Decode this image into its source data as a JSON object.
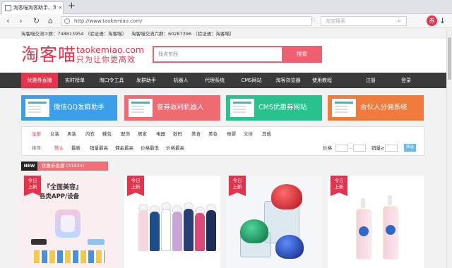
{
  "browser": {
    "tab_title": "淘客喵淘客助手、淘客内",
    "tab_close": "×",
    "new_tab": "+",
    "back_icon": "‹",
    "forward_icon": "›",
    "reload_icon": "↻",
    "home_icon": "⌂",
    "url": "http://www.taokemiao.com/",
    "star_icon": "☆",
    "search_placeholder": "淘宝搜索",
    "search_icon": "⌕",
    "extension_label": "券",
    "download_icon": "↓"
  },
  "qq": {
    "group1": "淘客喵交流①群：748813954 （验证语：淘客喵）",
    "group2": "淘客喵交流六群：60287396 （验证语：淘客喵）"
  },
  "header": {
    "logo_cn": "淘客喵",
    "logo_domain": "taokemiao.com",
    "logo_slogan": "只为让你更高效",
    "search_placeholder": "找点东西",
    "search_button": "搜索"
  },
  "nav": {
    "items": [
      "优惠券直播",
      "实时榜单",
      "淘口令工具",
      "发群助手",
      "机器人",
      "代理系统",
      "CMS网站",
      "淘客浏览器",
      "使用教程",
      "注册",
      "登录"
    ]
  },
  "banners": [
    {
      "text": "微信QQ发群助手",
      "color": "#3b9ee8"
    },
    {
      "text": "查券返利机器人",
      "color": "#f06a72"
    },
    {
      "text": "CMS优惠券网站",
      "color": "#27c28d"
    },
    {
      "text": "合伙人分佣系统",
      "color": "#f07b3c"
    }
  ],
  "filter": {
    "categories": [
      "全部",
      "女装",
      "男装",
      "内衣",
      "鞋包",
      "配饰",
      "居家",
      "电器",
      "数码",
      "美食",
      "美妆",
      "母婴",
      "文体",
      "其他"
    ],
    "sort_label": "排序:",
    "sorts": [
      "默认",
      "最新",
      "销量最高",
      "佣金最高",
      "价格最低",
      "价格最高"
    ],
    "price_label": "价格",
    "dash": "-",
    "sales_label": "销量≥",
    "filter_button": "筛选"
  },
  "section": {
    "badge": "NEW",
    "label": "优惠券直播 (31834)"
  },
  "products": [
    {
      "ribbon_line1": "今日",
      "ribbon_line2": "上新",
      "headline": "『全面美容』",
      "sub": "各类APP/设备"
    },
    {
      "ribbon_line1": "今日",
      "ribbon_line2": "上新"
    },
    {
      "ribbon_line1": "今日",
      "ribbon_line2": "上新"
    },
    {
      "ribbon_line1": "今日",
      "ribbon_line2": "上新"
    }
  ],
  "colors": {
    "brand": "#e6324b",
    "nav_bg": "#3a3a3a"
  }
}
